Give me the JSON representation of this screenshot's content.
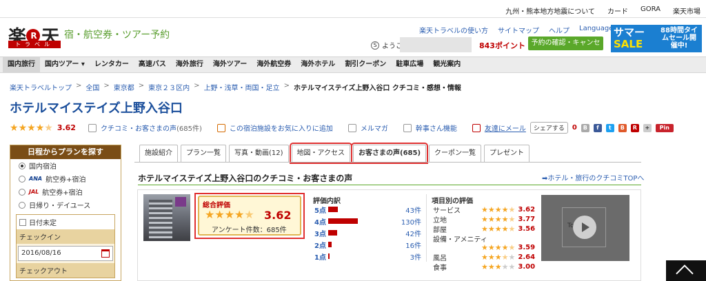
{
  "topbar": {
    "links": [
      "九州・熊本地方地震について",
      "カード",
      "GORA",
      "楽天市場"
    ]
  },
  "header": {
    "logo_main": "楽天",
    "logo_r": "R",
    "logo_sub": "トラベル",
    "tagline": "宿・航空券・ツアー予約",
    "links": [
      "楽天トラベルの使い方",
      "サイトマップ",
      "ヘルプ",
      "Languages ▾"
    ],
    "welcome": "ようこそ",
    "points": "843ポイント",
    "confirm_button": "予約の確認・キャンセル",
    "sale_line1": "サマー",
    "sale_line2": "SALE",
    "sale_right": "88時間タイムセール開催中!"
  },
  "nav": {
    "items": [
      "国内旅行",
      "国内ツアー ▾",
      "レンタカー",
      "高速バス",
      "海外旅行",
      "海外ツアー",
      "海外航空券",
      "海外ホテル",
      "割引クーポン",
      "駐車広場",
      "観光案内"
    ]
  },
  "breadcrumb": {
    "items": [
      "楽天トラベルトップ",
      "全国",
      "東京都",
      "東京２３区内",
      "上野・浅草・両国・足立"
    ],
    "current": "ホテルマイステイズ上野入谷口 クチコミ・感想・情報"
  },
  "hotel": {
    "title": "ホテルマイステイズ上野入谷口",
    "rating": "3.62",
    "review_link": "クチコミ・お客さまの声",
    "review_count": "(685件)",
    "favorite": "この宿泊施設をお気に入りに追加",
    "mailmag": "メルマガ",
    "kanji_feature": "幹事さん機能",
    "tell_friend": "友達にメール",
    "share": "シェアする",
    "share_count": "0"
  },
  "search_panel": {
    "heading": "日程からプランを探す",
    "options": [
      {
        "label": "国内宿泊",
        "airline": ""
      },
      {
        "label": "航空券+宿泊",
        "airline": "ANA"
      },
      {
        "label": "航空券+宿泊",
        "airline": "JAL"
      },
      {
        "label": "日帰り・デイユース",
        "airline": ""
      }
    ],
    "undecided": "日付未定",
    "checkin_label": "チェックイン",
    "checkin_value": "2016/08/16",
    "checkout_label": "チェックアウト"
  },
  "tabs": [
    "施設紹介",
    "プラン一覧",
    "写真・動画(12)",
    "地図・アクセス",
    "お客さまの声(685)",
    "クーポン一覧",
    "プレゼント"
  ],
  "reviews": {
    "section_title": "ホテルマイステイズ上野入谷口のクチコミ・お客さまの声",
    "top_link": "ホテル・旅行のクチコミTOPへ",
    "overall_label": "総合評価",
    "overall_score": "3.62",
    "survey_count": "アンケート件数：685件",
    "dist_title": "評価内訳",
    "distribution": [
      {
        "label": "5点",
        "count": "43件",
        "fraction": 0.11
      },
      {
        "label": "4点",
        "count": "130件",
        "fraction": 0.33
      },
      {
        "label": "3点",
        "count": "42件",
        "fraction": 0.1
      },
      {
        "label": "2点",
        "count": "16件",
        "fraction": 0.04
      },
      {
        "label": "1点",
        "count": "3件",
        "fraction": 0.01
      }
    ],
    "items_title": "項目別の評価",
    "items": [
      {
        "name": "サービス",
        "score": "3.62"
      },
      {
        "name": "立地",
        "score": "3.77"
      },
      {
        "name": "部屋",
        "score": "3.56"
      },
      {
        "name": "設備・アメニティ",
        "score": "3.59"
      },
      {
        "name": "風呂",
        "score": "2.64"
      },
      {
        "name": "食事",
        "score": "3.00"
      }
    ],
    "video_text": "Toy Box"
  },
  "colors": {
    "brand_red": "#bf0000",
    "green": "#5aa82a",
    "link": "#2a5db0",
    "title": "#1a4e9b"
  }
}
